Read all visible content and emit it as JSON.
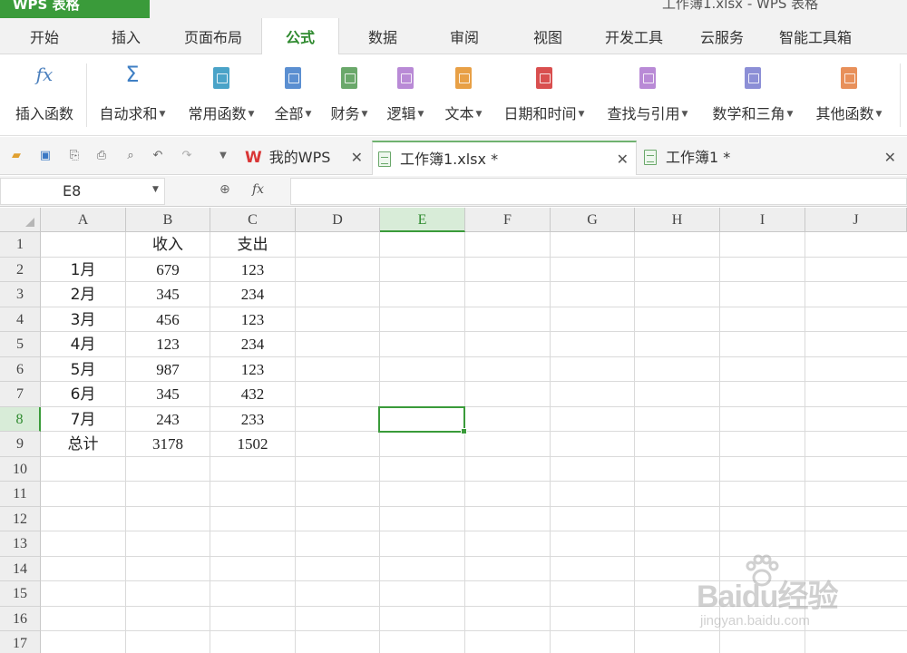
{
  "titlebar": {
    "app_name": "WPS 表格",
    "doc_title": "工作簿1.xlsx  -  WPS 表格"
  },
  "menu": {
    "tabs": [
      "开始",
      "插入",
      "页面布局",
      "公式",
      "数据",
      "审阅",
      "视图",
      "开发工具",
      "云服务",
      "智能工具箱"
    ],
    "active": "公式"
  },
  "ribbon": {
    "insert_function": "插入函数",
    "autosum": "自动求和",
    "common": "常用函数",
    "all": "全部",
    "finance": "财务",
    "logic": "逻辑",
    "text": "文本",
    "datetime": "日期和时间",
    "lookup": "查找与引用",
    "math": "数学和三角",
    "other": "其他函数"
  },
  "doc_tabs": {
    "wps_home": "我的WPS",
    "book_xlsx": "工作簿1.xlsx *",
    "book_unsaved": "工作簿1 *"
  },
  "formula_bar": {
    "name_box": "E8",
    "formula": ""
  },
  "grid": {
    "columns": [
      "A",
      "B",
      "C",
      "D",
      "E",
      "F",
      "G",
      "H",
      "I",
      "J"
    ],
    "rows": [
      "1",
      "2",
      "3",
      "4",
      "5",
      "6",
      "7",
      "8",
      "9",
      "10",
      "11",
      "12",
      "13",
      "14",
      "15",
      "16",
      "17"
    ],
    "selected_column": "E",
    "selected_row": "8",
    "headers": {
      "income": "收入",
      "expense": "支出"
    },
    "data": [
      {
        "month": "1月",
        "income": "679",
        "expense": "123"
      },
      {
        "month": "2月",
        "income": "345",
        "expense": "234"
      },
      {
        "month": "3月",
        "income": "456",
        "expense": "123"
      },
      {
        "month": "4月",
        "income": "123",
        "expense": "234"
      },
      {
        "month": "5月",
        "income": "987",
        "expense": "123"
      },
      {
        "month": "6月",
        "income": "345",
        "expense": "432"
      },
      {
        "month": "7月",
        "income": "243",
        "expense": "233"
      }
    ],
    "total": {
      "label": "总计",
      "income": "3178",
      "expense": "1502"
    }
  },
  "watermark": {
    "main": "Baidu经验",
    "sub": "jingyan.baidu.com"
  },
  "colors": {
    "accent": "#3a9b3a",
    "ribbon_icons": [
      "#4aa3c8",
      "#5b8fd1",
      "#6aa86a",
      "#b98ad6",
      "#e8a046",
      "#d94f4f",
      "#b98ad6",
      "#8c8fd6",
      "#e8905a"
    ]
  }
}
